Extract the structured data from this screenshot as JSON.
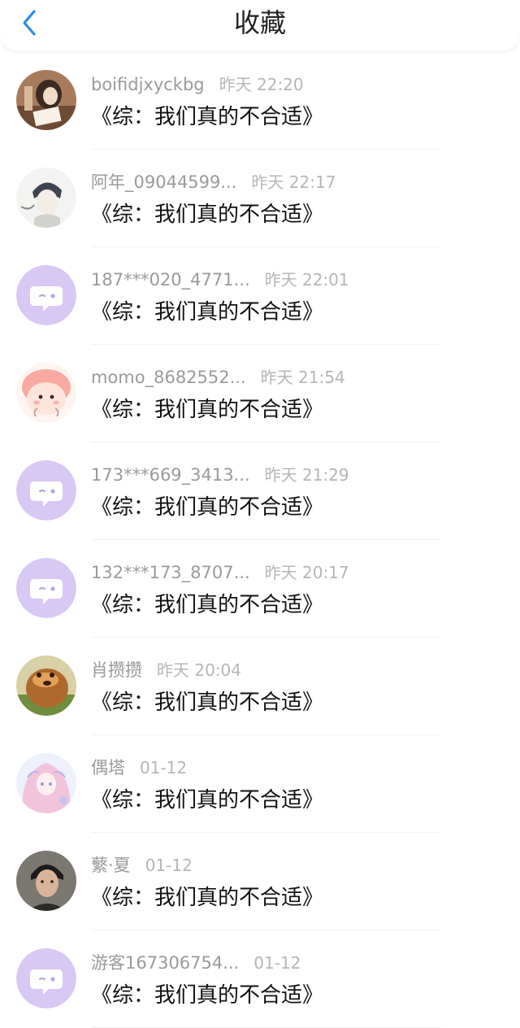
{
  "header": {
    "title": "收藏",
    "back_icon": "chevron-left-icon",
    "accent_color": "#2a8be8"
  },
  "items": [
    {
      "username": "boifidjxyckbg",
      "time": "昨天 22:20",
      "title": "《综：我们真的不合适》",
      "avatar": "photo-girl-reading"
    },
    {
      "username": "阿年_09044599...",
      "time": "昨天 22:17",
      "title": "《综：我们真的不合适》",
      "avatar": "anime-boy-sketch"
    },
    {
      "username": "187***020_4771...",
      "time": "昨天 22:01",
      "title": "《综：我们真的不合适》",
      "avatar": "default-chat-bubble"
    },
    {
      "username": "momo_8682552...",
      "time": "昨天 21:54",
      "title": "《综：我们真的不合适》",
      "avatar": "pink-cartoon-face"
    },
    {
      "username": "173***669_3413...",
      "time": "昨天 21:29",
      "title": "《综：我们真的不合适》",
      "avatar": "default-chat-bubble"
    },
    {
      "username": "132***173_8707...",
      "time": "昨天 20:17",
      "title": "《综：我们真的不合适》",
      "avatar": "default-chat-bubble"
    },
    {
      "username": "肖攒攒",
      "time": "昨天 20:04",
      "title": "《综：我们真的不合适》",
      "avatar": "cartoon-bear"
    },
    {
      "username": "偶塔",
      "time": "01-12",
      "title": "《综：我们真的不合适》",
      "avatar": "anime-girl-pink-hair"
    },
    {
      "username": "蘩·夏",
      "time": "01-12",
      "title": "《综：我们真的不合适》",
      "avatar": "photo-young-man"
    },
    {
      "username": "游客167306754...",
      "time": "01-12",
      "title": "《综：我们真的不合适》",
      "avatar": "default-chat-bubble"
    }
  ]
}
